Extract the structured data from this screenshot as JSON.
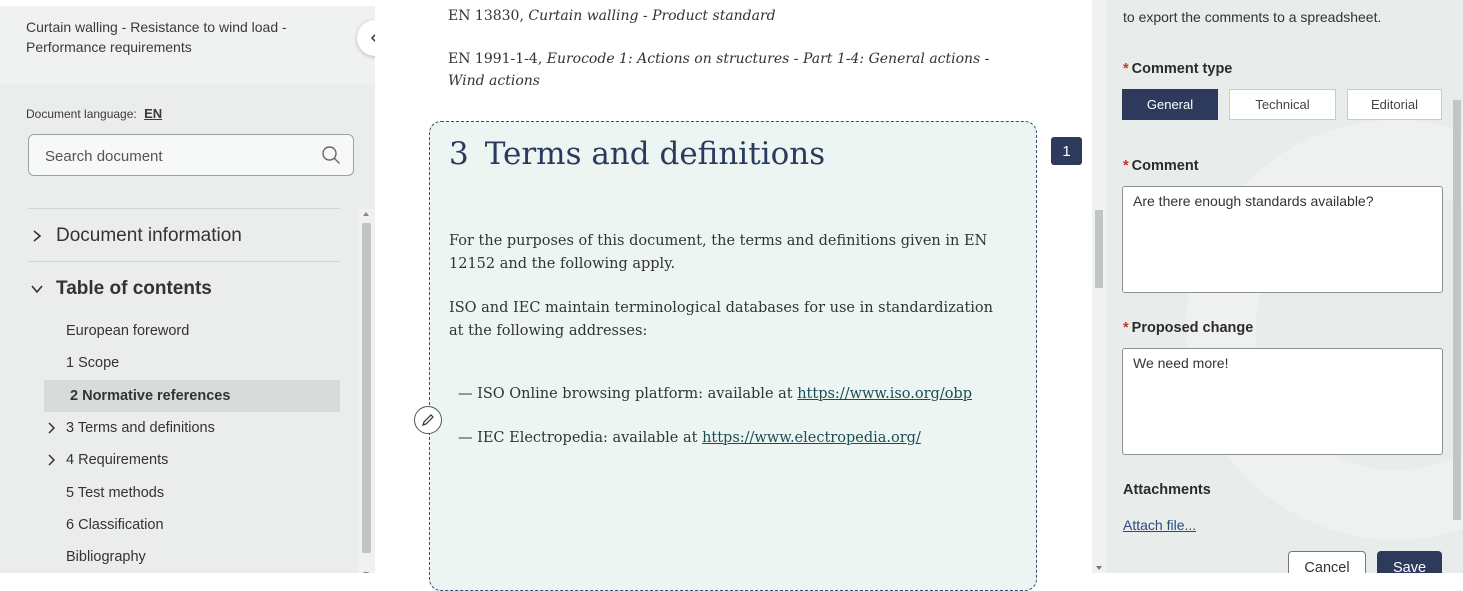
{
  "sidebar": {
    "doc_title": "Curtain walling - Resistance to wind load - Performance requirements",
    "language_label": "Document language:",
    "language_code": "EN",
    "search_placeholder": "Search document",
    "sections": {
      "document_information": "Document information",
      "table_of_contents": "Table of contents"
    },
    "toc": [
      {
        "label": "European foreword"
      },
      {
        "label": "1 Scope"
      },
      {
        "label": "2 Normative references"
      },
      {
        "label": "3 Terms and definitions"
      },
      {
        "label": "4 Requirements"
      },
      {
        "label": "5 Test methods"
      },
      {
        "label": "6 Classification"
      },
      {
        "label": "Bibliography"
      }
    ]
  },
  "document": {
    "refs": [
      {
        "code": "EN 13830,",
        "title": "Curtain walling - Product standard"
      },
      {
        "code": "EN 1991-1-4,",
        "title": "Eurocode 1: Actions on structures - Part 1-4: General actions - Wind actions"
      }
    ],
    "section": {
      "number": "3",
      "title": "Terms and definitions",
      "para1": "For the purposes of this document, the terms and definitions given in EN 12152 and the following apply.",
      "para2": "ISO and IEC maintain terminological databases for use in standardization at the following addresses:",
      "items": [
        {
          "prefix": "— ISO Online browsing platform: available at ",
          "link": "https://www.iso.org/obp"
        },
        {
          "prefix": "— IEC Electropedia: available at ",
          "link": "https://www.electropedia.org/"
        }
      ]
    },
    "comment_count": "1"
  },
  "panel": {
    "intro_text": "to export the comments to a spreadsheet.",
    "required_mark": "*",
    "comment_type_label": "Comment type",
    "comment_types": [
      "General",
      "Technical",
      "Editorial"
    ],
    "selected_comment_type": "General",
    "comment_label": "Comment",
    "comment_value": "Are there enough standards available?",
    "proposed_change_label": "Proposed change",
    "proposed_change_value": "We need more!",
    "attachments_label": "Attachments",
    "attach_link": "Attach file...",
    "cancel_label": "Cancel",
    "save_label": "Save"
  },
  "colors": {
    "accent": "#2d3a5c",
    "required": "#c0392b",
    "link": "#1a4e55",
    "sidebar_bg": "#eaedec",
    "section_bg": "#edf5f2"
  }
}
